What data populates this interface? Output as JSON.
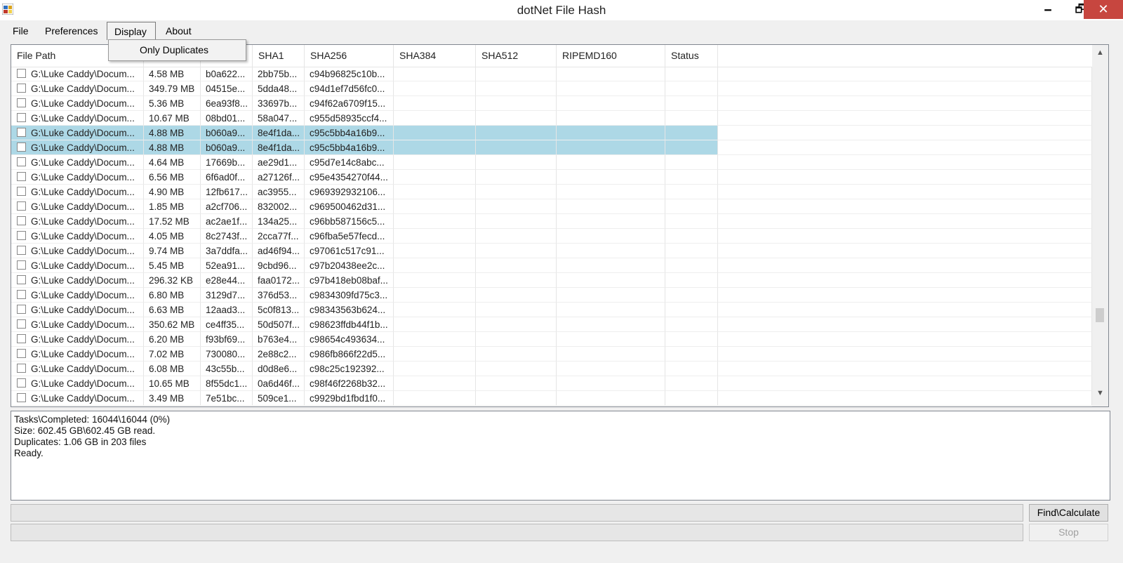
{
  "window": {
    "title": "dotNet File Hash",
    "icon": "app-icon"
  },
  "window_controls": {
    "minimize": "🗕",
    "maximize": "🗗",
    "close": "✕"
  },
  "menu": {
    "items": [
      "File",
      "Preferences",
      "Display",
      "About"
    ],
    "open_menu": "Display",
    "dropdown_items": [
      "Only Duplicates"
    ]
  },
  "grid": {
    "columns": [
      "File Path",
      "",
      "",
      "SHA1",
      "SHA256",
      "SHA384",
      "SHA512",
      "RIPEMD160",
      "Status"
    ],
    "rows": [
      {
        "path": "G:\\Luke Caddy\\Docum...",
        "size": "4.58 MB",
        "md5": "b0a622...",
        "sha1": "2bb75b...",
        "sha256": "c94b96825c10b...",
        "selected": false
      },
      {
        "path": "G:\\Luke Caddy\\Docum...",
        "size": "349.79 MB",
        "md5": "04515e...",
        "sha1": "5dda48...",
        "sha256": "c94d1ef7d56fc0...",
        "selected": false
      },
      {
        "path": "G:\\Luke Caddy\\Docum...",
        "size": "5.36 MB",
        "md5": "6ea93f8...",
        "sha1": "33697b...",
        "sha256": "c94f62a6709f15...",
        "selected": false
      },
      {
        "path": "G:\\Luke Caddy\\Docum...",
        "size": "10.67 MB",
        "md5": "08bd01...",
        "sha1": "58a047...",
        "sha256": "c955d58935ccf4...",
        "selected": false
      },
      {
        "path": "G:\\Luke Caddy\\Docum...",
        "size": "4.88 MB",
        "md5": "b060a9...",
        "sha1": "8e4f1da...",
        "sha256": "c95c5bb4a16b9...",
        "selected": true
      },
      {
        "path": "G:\\Luke Caddy\\Docum...",
        "size": "4.88 MB",
        "md5": "b060a9...",
        "sha1": "8e4f1da...",
        "sha256": "c95c5bb4a16b9...",
        "selected": true
      },
      {
        "path": "G:\\Luke Caddy\\Docum...",
        "size": "4.64 MB",
        "md5": "17669b...",
        "sha1": "ae29d1...",
        "sha256": "c95d7e14c8abc...",
        "selected": false
      },
      {
        "path": "G:\\Luke Caddy\\Docum...",
        "size": "6.56 MB",
        "md5": "6f6ad0f...",
        "sha1": "a27126f...",
        "sha256": "c95e4354270f44...",
        "selected": false
      },
      {
        "path": "G:\\Luke Caddy\\Docum...",
        "size": "4.90 MB",
        "md5": "12fb617...",
        "sha1": "ac3955...",
        "sha256": "c969392932106...",
        "selected": false
      },
      {
        "path": "G:\\Luke Caddy\\Docum...",
        "size": "1.85 MB",
        "md5": "a2cf706...",
        "sha1": "832002...",
        "sha256": "c969500462d31...",
        "selected": false
      },
      {
        "path": "G:\\Luke Caddy\\Docum...",
        "size": "17.52 MB",
        "md5": "ac2ae1f...",
        "sha1": "134a25...",
        "sha256": "c96bb587156c5...",
        "selected": false
      },
      {
        "path": "G:\\Luke Caddy\\Docum...",
        "size": "4.05 MB",
        "md5": "8c2743f...",
        "sha1": "2cca77f...",
        "sha256": "c96fba5e57fecd...",
        "selected": false
      },
      {
        "path": "G:\\Luke Caddy\\Docum...",
        "size": "9.74 MB",
        "md5": "3a7ddfa...",
        "sha1": "ad46f94...",
        "sha256": "c97061c517c91...",
        "selected": false
      },
      {
        "path": "G:\\Luke Caddy\\Docum...",
        "size": "5.45 MB",
        "md5": "52ea91...",
        "sha1": "9cbd96...",
        "sha256": "c97b20438ee2c...",
        "selected": false
      },
      {
        "path": "G:\\Luke Caddy\\Docum...",
        "size": "296.32 KB",
        "md5": "e28e44...",
        "sha1": "faa0172...",
        "sha256": "c97b418eb08baf...",
        "selected": false
      },
      {
        "path": "G:\\Luke Caddy\\Docum...",
        "size": "6.80 MB",
        "md5": "3129d7...",
        "sha1": "376d53...",
        "sha256": "c9834309fd75c3...",
        "selected": false
      },
      {
        "path": "G:\\Luke Caddy\\Docum...",
        "size": "6.63 MB",
        "md5": "12aad3...",
        "sha1": "5c0f813...",
        "sha256": "c98343563b624...",
        "selected": false
      },
      {
        "path": "G:\\Luke Caddy\\Docum...",
        "size": "350.62 MB",
        "md5": "ce4ff35...",
        "sha1": "50d507f...",
        "sha256": "c98623ffdb44f1b...",
        "selected": false
      },
      {
        "path": "G:\\Luke Caddy\\Docum...",
        "size": "6.20 MB",
        "md5": "f93bf69...",
        "sha1": "b763e4...",
        "sha256": "c98654c493634...",
        "selected": false
      },
      {
        "path": "G:\\Luke Caddy\\Docum...",
        "size": "7.02 MB",
        "md5": "730080...",
        "sha1": "2e88c2...",
        "sha256": "c986fb866f22d5...",
        "selected": false
      },
      {
        "path": "G:\\Luke Caddy\\Docum...",
        "size": "6.08 MB",
        "md5": "43c55b...",
        "sha1": "d0d8e6...",
        "sha256": "c98c25c192392...",
        "selected": false
      },
      {
        "path": "G:\\Luke Caddy\\Docum...",
        "size": "10.65 MB",
        "md5": "8f55dc1...",
        "sha1": "0a6d46f...",
        "sha256": "c98f46f2268b32...",
        "selected": false
      },
      {
        "path": "G:\\Luke Caddy\\Docum...",
        "size": "3.49 MB",
        "md5": "7e51bc...",
        "sha1": "509ce1...",
        "sha256": "c9929bd1fbd1f0...",
        "selected": false
      }
    ]
  },
  "log": [
    "Tasks\\Completed: 16044\\16044 (0%)",
    "Size: 602.45 GB\\602.45 GB read.",
    "Duplicates: 1.06 GB in 203 files",
    "Ready."
  ],
  "progress": {
    "bar1_fraction": 0,
    "bar2_fraction": 0
  },
  "buttons": {
    "find": "Find\\Calculate",
    "stop": "Stop"
  },
  "colors": {
    "selection": "#add8e6",
    "close_button": "#c7463f"
  },
  "scrollbar": {
    "up_icon": "▲",
    "down_icon": "▼"
  }
}
